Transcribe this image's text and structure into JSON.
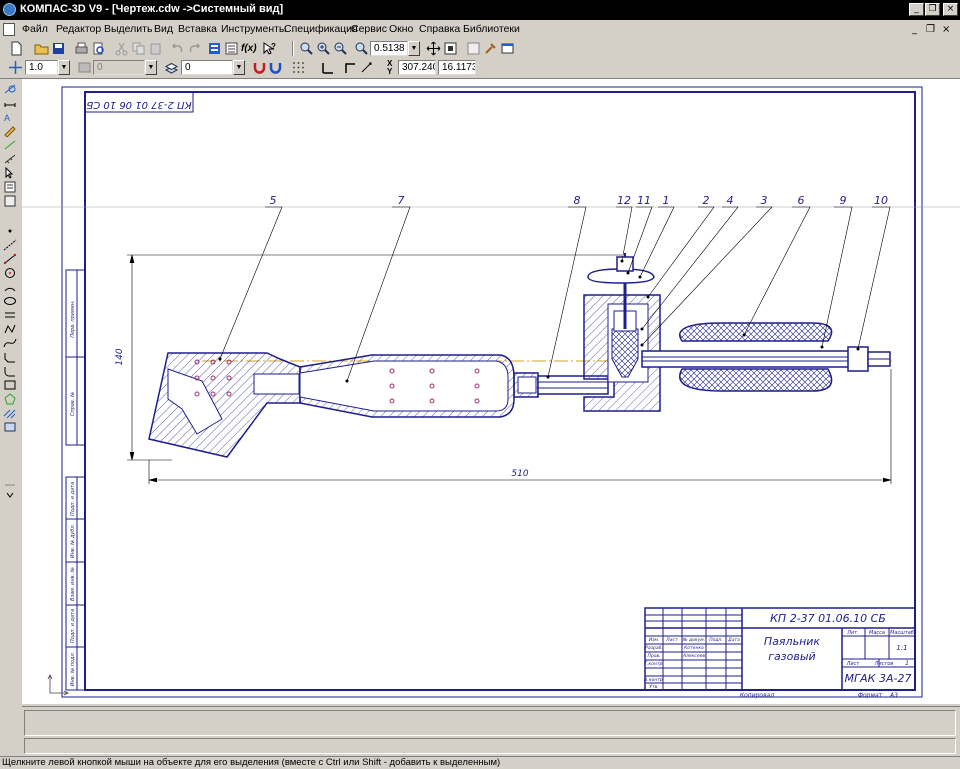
{
  "window": {
    "title": "КОМПАС-3D V9 - [Чертеж.cdw ->Системный вид]",
    "controls": {
      "minimize": "_",
      "restore": "❐",
      "close": "×"
    }
  },
  "menu": {
    "items": [
      "Файл",
      "Редактор",
      "Выделить",
      "Вид",
      "Вставка",
      "Инструменты",
      "Спецификация",
      "Сервис",
      "Окно",
      "Справка",
      "Библиотеки"
    ],
    "mdi_controls": {
      "minimize": "_",
      "restore": "❐",
      "close": "×"
    }
  },
  "toolbar": {
    "zoom_value": "0.5138",
    "step_value": "1.0",
    "layer_style_value": "0",
    "layer_value": "0",
    "coord_x": "307.240",
    "coord_y": "16.1173",
    "coord_label_x": "X",
    "coord_label_y": "Y",
    "fx_label": "f(x)"
  },
  "drawing": {
    "rotated_code": "КП 2-37 01 06 10 СБ",
    "part_numbers": [
      "5",
      "7",
      "8",
      "12",
      "11",
      "1",
      "2",
      "4",
      "3",
      "6",
      "9",
      "10"
    ],
    "dim_height": "140",
    "dim_width": "510",
    "title_block": {
      "code": "КП 2-37 01.06.10 СБ",
      "name_line1": "Паяльник",
      "name_line2": "газовый",
      "org": "МГАК 3А-27",
      "col_lit": "Лит.",
      "col_mass": "Масса",
      "col_scale": "Масштаб",
      "scale_value": "1:1",
      "sheet_label": "Лист",
      "sheets_label": "Листов",
      "sheets_count": "1",
      "change_label": "Изм.",
      "sheet_col_label": "Лист",
      "doc_num_label": "№ докум.",
      "sign_label": "Подп.",
      "date_label": "Дата",
      "developer_label": "Разраб.",
      "developer_name": "Котенко",
      "checker_label": "Пров.",
      "checker_name": "Алексеев",
      "tcontrol_label": "Т.контр.",
      "ncontrol_label": "Н.контр.",
      "approved_label": "Утв.",
      "copied_label": "Копировал",
      "format_label": "Формат",
      "format_value": "А3"
    },
    "side_stamps": [
      "Перв. примен.",
      "Справ. №",
      "Подп. и дата",
      "Инв. № дубл.",
      "Взам. инв. №",
      "Подп. и дата",
      "Инв. № подл."
    ]
  },
  "status": {
    "hint": "Щелкните левой кнопкой мыши на объекте для его выделения (вместе с Ctrl или Shift - добавить к выделенным)"
  },
  "colors": {
    "frame": "#1e1e8c",
    "centerline": "#d4a020",
    "leader": "#000000",
    "crosshair": "#a0a0a0"
  }
}
